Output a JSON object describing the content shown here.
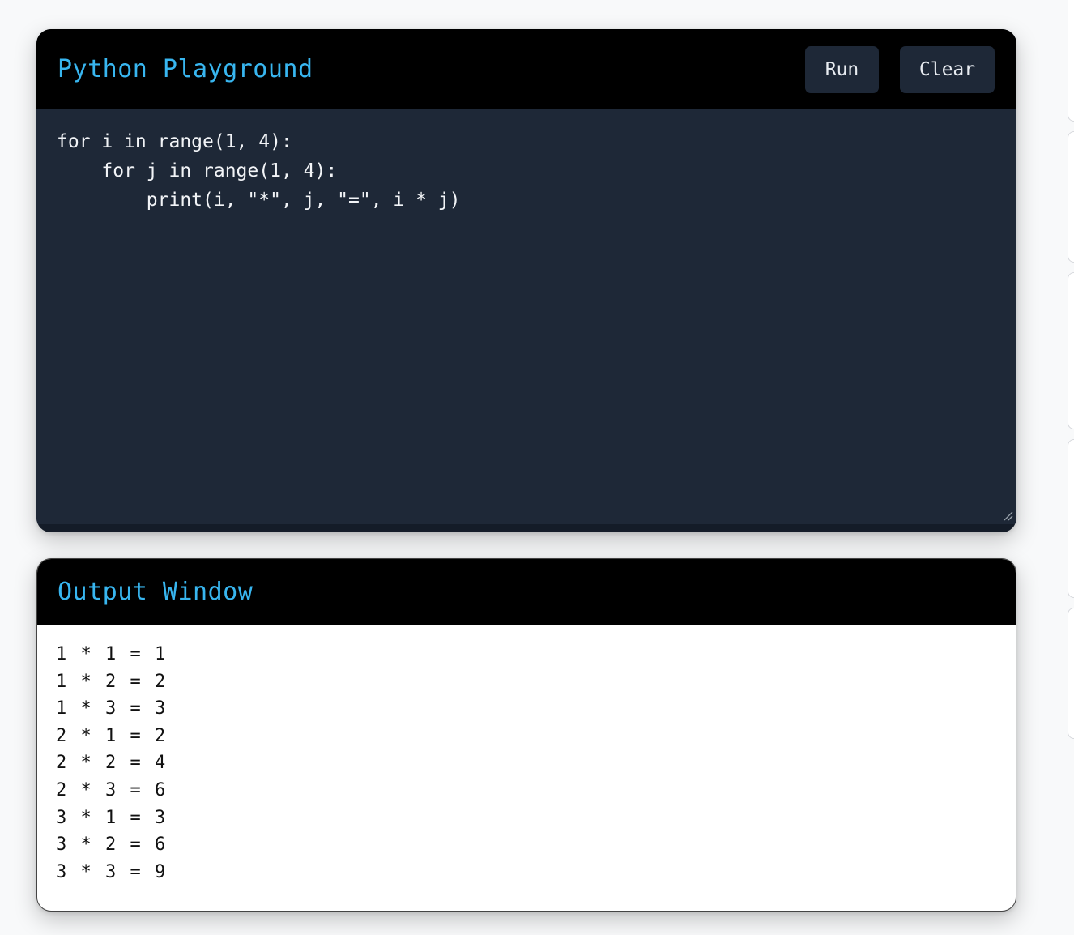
{
  "editor": {
    "title": "Python Playground",
    "run_label": "Run",
    "clear_label": "Clear",
    "code_lines": [
      "for i in range(1, 4):",
      "    for j in range(1, 4):",
      "        print(i, \"*\", j, \"=\", i * j)"
    ]
  },
  "output": {
    "title": "Output Window",
    "lines": [
      "1 * 1 = 1",
      "1 * 2 = 2",
      "1 * 3 = 3",
      "2 * 1 = 2",
      "2 * 2 = 4",
      "2 * 3 = 6",
      "3 * 1 = 3",
      "3 * 2 = 6",
      "3 * 3 = 9"
    ]
  },
  "colors": {
    "accent": "#38b6f0",
    "header_bg": "#000000",
    "editor_bg": "#1e2837",
    "output_bg": "#ffffff"
  }
}
